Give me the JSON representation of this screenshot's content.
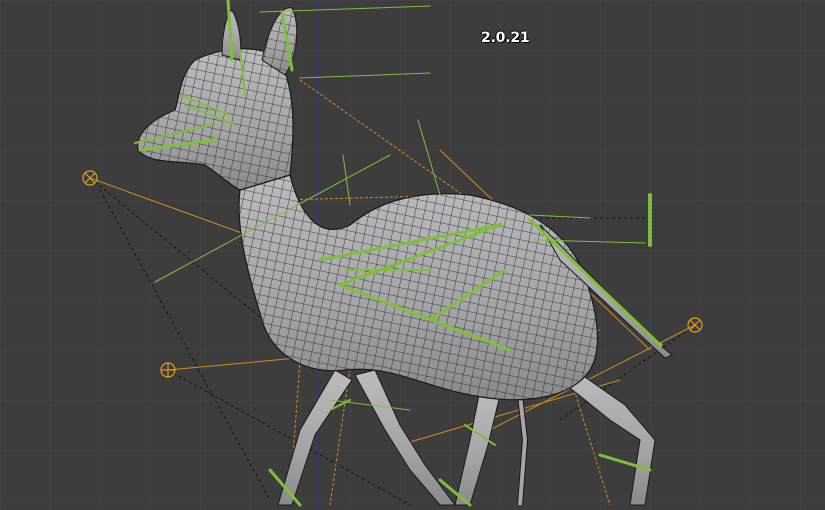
{
  "viewport": {
    "version_text": "2.0.21",
    "background_color": "#3d3d3d",
    "grid_color": "#474747",
    "axis_line_color": "#2e3a8c",
    "mesh_fill_color": "#a9a9ab",
    "mesh_wire_color": "#1a1a1a",
    "bone_color": "#7fbf3a",
    "constraint_line_color": "#d4891e",
    "empty_target_color": "#e0a020"
  },
  "scene": {
    "object": "deer-mesh",
    "armature": "deer-armature",
    "targets": [
      "target-empty-left",
      "target-empty-front",
      "target-empty-right",
      "bone-chain-tail"
    ]
  }
}
